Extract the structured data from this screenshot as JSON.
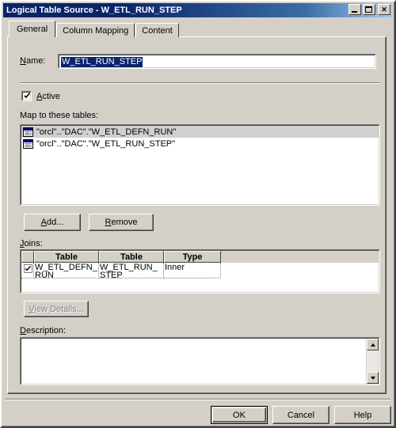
{
  "window": {
    "title": "Logical Table Source - W_ETL_RUN_STEP",
    "buttons": {
      "minimize": "minimize-button",
      "maximize": "maximize-button",
      "close": "✕"
    }
  },
  "tabs": [
    {
      "label": "General",
      "active": true
    },
    {
      "label": "Column Mapping",
      "active": false
    },
    {
      "label": "Content",
      "active": false
    }
  ],
  "general": {
    "name_label": "Name:",
    "name_accel": "N",
    "name_value": "W_ETL_RUN_STEP",
    "active_checkbox": {
      "label": "Active",
      "accel": "A",
      "checked": true
    },
    "map_label": "Map to these tables:",
    "tables": [
      {
        "text": "\"orcl\"..\"DAC\".\"W_ETL_DEFN_RUN\"",
        "selected": true
      },
      {
        "text": "\"orcl\"..\"DAC\".\"W_ETL_RUN_STEP\"",
        "selected": false
      }
    ],
    "add_button": "Add...",
    "add_accel": "A",
    "remove_button": "Remove",
    "remove_accel": "R",
    "joins_label": "Joins:",
    "joins_accel": "J",
    "joins_columns": [
      "",
      "Table",
      "Table",
      "Type"
    ],
    "joins_rows": [
      {
        "checked": true,
        "table1": "W_ETL_DEFN_RUN",
        "table2": "W_ETL_RUN_STEP",
        "type": "Inner"
      }
    ],
    "view_details_button": "View Details...",
    "view_details_accel": "V",
    "view_details_disabled": true,
    "description_label": "Description:",
    "description_accel": "D",
    "description_value": ""
  },
  "footer": {
    "ok": "OK",
    "cancel": "Cancel",
    "help": "Help"
  },
  "colors": {
    "face": "#d4d0c8",
    "title_active_start": "#0a246a",
    "title_active_end": "#a6caf0",
    "highlight": "#0a246a",
    "selection_row": "#d0d0d0",
    "icon_header": "#000080"
  }
}
